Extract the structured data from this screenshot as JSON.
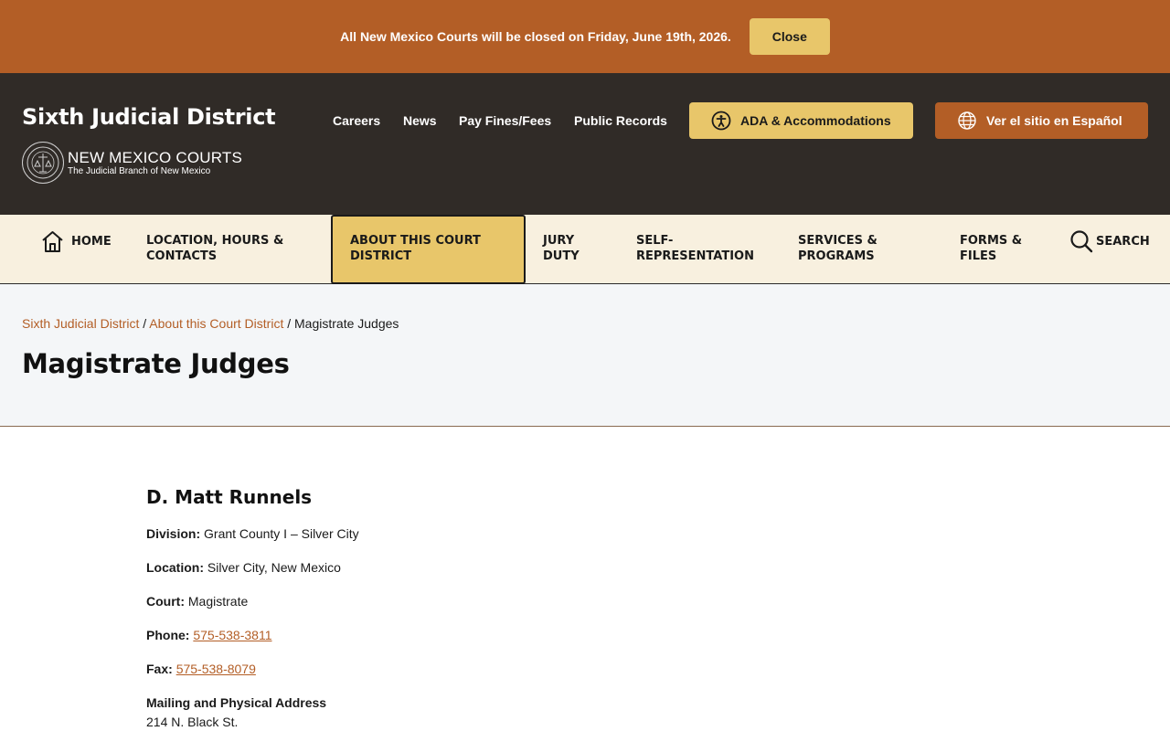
{
  "alert": {
    "message": "All New Mexico Courts will be closed on Friday, June 19th, 2026.",
    "close_label": "Close"
  },
  "header": {
    "site_title": "Sixth Judicial District",
    "logo_name": "NEW MEXICO COURTS",
    "logo_sub": "The Judicial Branch of New Mexico",
    "links": [
      "Careers",
      "News",
      "Pay Fines/Fees",
      "Public Records"
    ],
    "ada_label": "ADA & Accommodations",
    "spanish_label": "Ver el sitio en Español"
  },
  "nav": {
    "home": "HOME",
    "location": [
      "LOCATION, HOURS &",
      "CONTACTS"
    ],
    "about": [
      "ABOUT THIS COURT",
      "DISTRICT"
    ],
    "jury": [
      "JURY",
      "DUTY"
    ],
    "self_rep": [
      "SELF-",
      "REPRESENTATION"
    ],
    "services": [
      "SERVICES &",
      "PROGRAMS"
    ],
    "forms": [
      "FORMS &",
      "FILES"
    ],
    "search": "SEARCH"
  },
  "breadcrumb": {
    "home": "Sixth Judicial District",
    "parent": "About this Court District",
    "current": "Magistrate Judges"
  },
  "page_title": "Magistrate Judges",
  "judge": {
    "name": "D. Matt Runnels",
    "division_label": "Division:",
    "division": "Grant County I – Silver City",
    "location_label": "Location:",
    "location": "Silver City, New Mexico",
    "court_label": "Court:",
    "court": "Magistrate",
    "phone_label": "Phone:",
    "phone": "575-538-3811",
    "fax_label": "Fax:",
    "fax": "575-538-8079",
    "address_heading": "Mailing and Physical Address",
    "address_line1": "214 N. Black St."
  },
  "colors": {
    "brand_orange": "#b35e26",
    "gold": "#e8c66a",
    "header_dark": "#302b27",
    "nav_cream": "#f8f0df"
  }
}
